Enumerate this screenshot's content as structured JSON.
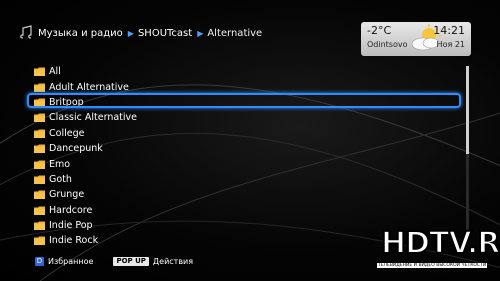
{
  "breadcrumb": {
    "items": [
      "Музыка и радио",
      "SHOUTcast",
      "Alternative"
    ]
  },
  "weather": {
    "temperature": "-2°C",
    "city": "Odintsovo",
    "time": "14:21",
    "date": "Ноя 21"
  },
  "list": {
    "items": [
      {
        "label": "All"
      },
      {
        "label": "Adult Alternative"
      },
      {
        "label": "Britpop",
        "selected": true
      },
      {
        "label": "Classic Alternative"
      },
      {
        "label": "College"
      },
      {
        "label": "Dancepunk"
      },
      {
        "label": "Emo"
      },
      {
        "label": "Goth"
      },
      {
        "label": "Grunge"
      },
      {
        "label": "Hardcore"
      },
      {
        "label": "Indie Pop"
      },
      {
        "label": "Indie Rock"
      }
    ]
  },
  "footer": {
    "key_d": "D",
    "favorites_label": "Избранное",
    "popup_key": "POP UP",
    "actions_label": "Действия"
  },
  "logo": {
    "text": "HDTV.RU",
    "subtitle": "ТЕЛЕВИДЕНИЕ И ВИДЕО ВЫСОКОЙ ЧЕТКОСТИ"
  },
  "colors": {
    "accent": "#2f8cff",
    "folder": "#f2b233"
  }
}
